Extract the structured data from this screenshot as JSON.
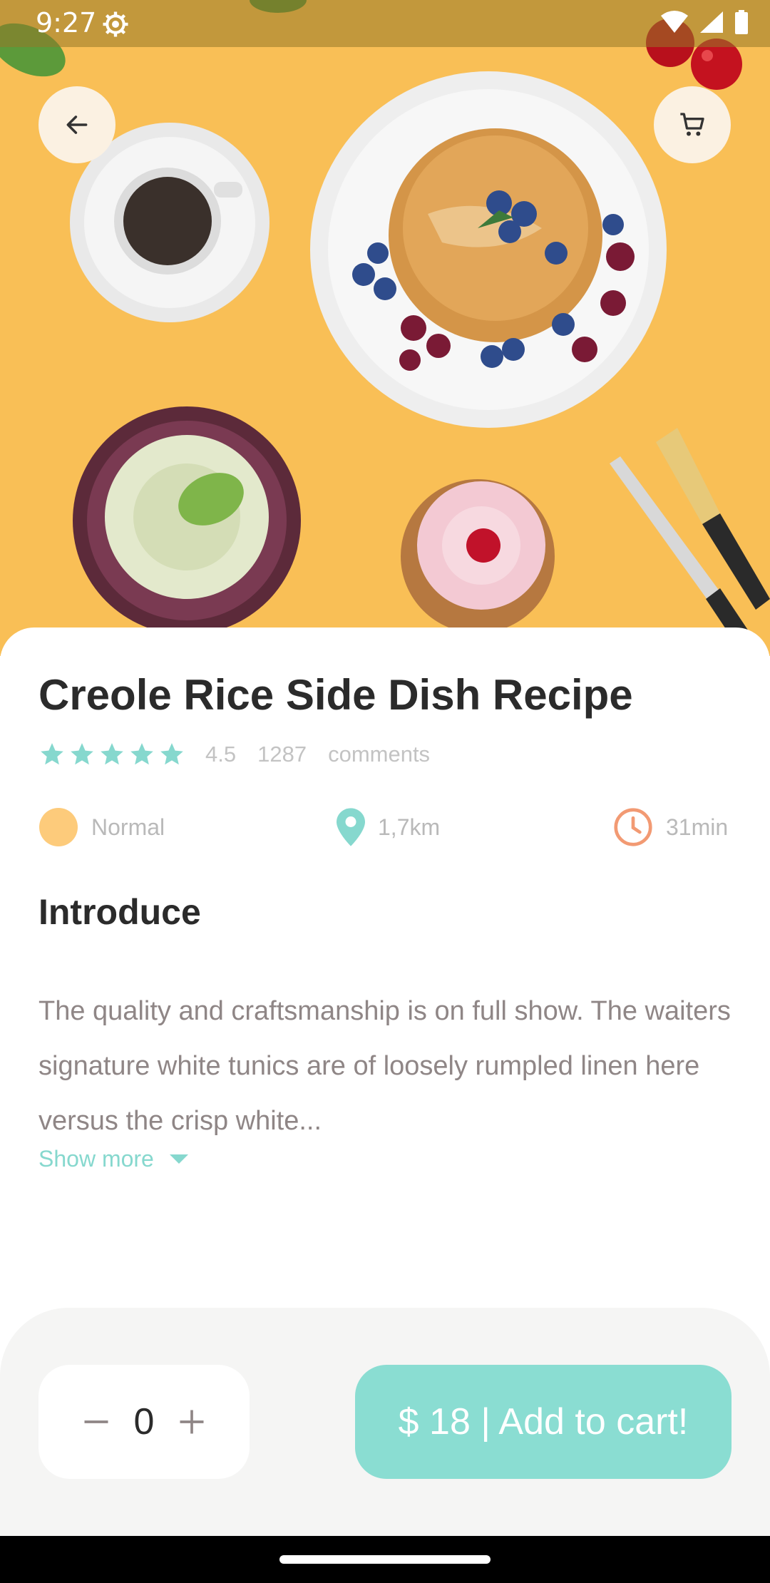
{
  "status_bar": {
    "time": "9:27"
  },
  "header": {
    "back_icon": "arrow-left-icon",
    "cart_icon": "shopping-cart-icon"
  },
  "recipe": {
    "title": "Creole Rice Side Dish Recipe",
    "rating": "4.5",
    "rating_value": 4.5,
    "stars_shown": 5,
    "comment_count": "1287",
    "comment_label": "comments",
    "difficulty": "Normal",
    "distance": "1,7km",
    "time": "31min"
  },
  "intro": {
    "heading": "Introduce",
    "text": "The quality and craftsmanship is on full show. The waiters  signature white tunics are of loosely rumpled linen here versus the crisp white...",
    "show_more": "Show more"
  },
  "cart": {
    "quantity": "0",
    "add_label": "$ 18 | Add to cart!"
  },
  "colors": {
    "accent": "#86D8CE",
    "hero_bg": "#F9BF56",
    "button": "#8ADDD2",
    "difficulty_dot": "#FDCB7B",
    "clock": "#F29A73"
  }
}
